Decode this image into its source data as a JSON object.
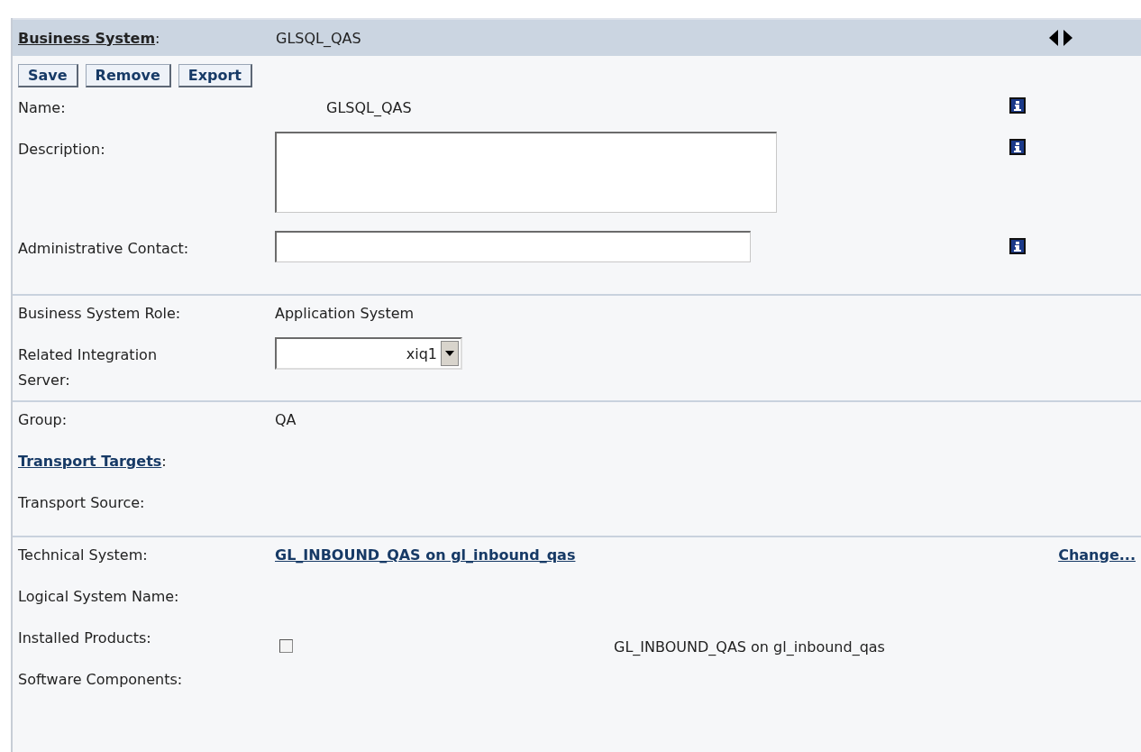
{
  "header": {
    "label": "Business System",
    "label_suffix": ":",
    "value": "GLSQL_QAS"
  },
  "buttons": [
    "Save",
    "Remove",
    "Export"
  ],
  "sections": [
    [
      {
        "kind": "title",
        "label": "Name:",
        "value": "GLSQL_QAS",
        "info": true
      },
      {
        "kind": "textarea",
        "label": "Description:",
        "info": true
      },
      {
        "kind": "input",
        "label": "Administrative Contact:",
        "info": true
      }
    ],
    [
      {
        "kind": "text",
        "label": "Business System Role:",
        "value": "Application System"
      },
      {
        "kind": "select",
        "label": "Related Integration Server:",
        "value": "xiq1"
      }
    ],
    [
      {
        "kind": "text",
        "label": "Group:",
        "value": "QA"
      },
      {
        "kind": "link_label",
        "label": "Transport Targets",
        "label_suffix": ":"
      },
      {
        "kind": "text",
        "label": "Transport Source:"
      }
    ],
    [
      {
        "kind": "link_value",
        "label": "Technical System:",
        "value": "GL_INBOUND_QAS on gl_inbound_qas",
        "action": "Change..."
      },
      {
        "kind": "text",
        "label": "Logical System Name:"
      },
      {
        "kind": "checkbox",
        "label": "Installed Products:",
        "checked": false,
        "value": "GL_INBOUND_QAS on gl_inbound_qas"
      },
      {
        "kind": "text",
        "label": "Software Components:"
      }
    ]
  ]
}
